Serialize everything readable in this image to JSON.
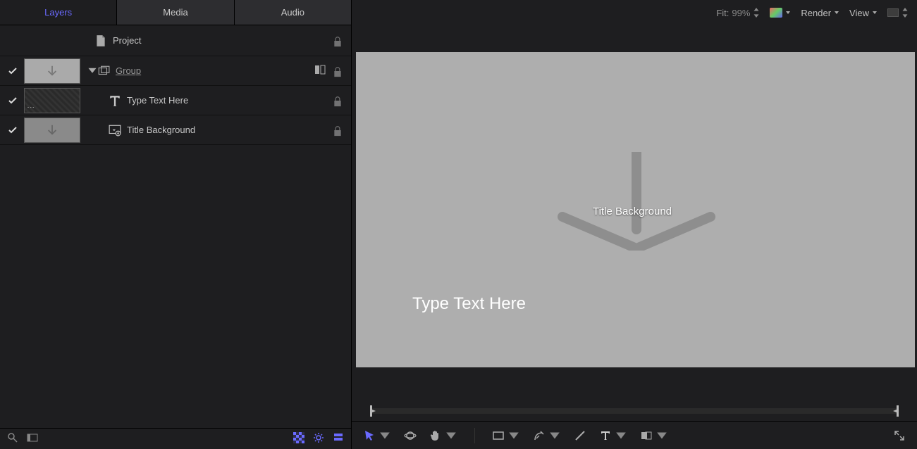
{
  "tabs": {
    "layers": "Layers",
    "media": "Media",
    "audio": "Audio"
  },
  "project": {
    "label": "Project"
  },
  "group": {
    "label": "Group"
  },
  "text_layer": {
    "label": "Type Text Here"
  },
  "title_bg": {
    "label": "Title Background"
  },
  "canvas": {
    "title_bg_label": "Title Background",
    "type_text": "Type Text Here"
  },
  "toolbar": {
    "fit_label": "Fit:",
    "fit_pct": "99%",
    "render": "Render",
    "view": "View"
  }
}
